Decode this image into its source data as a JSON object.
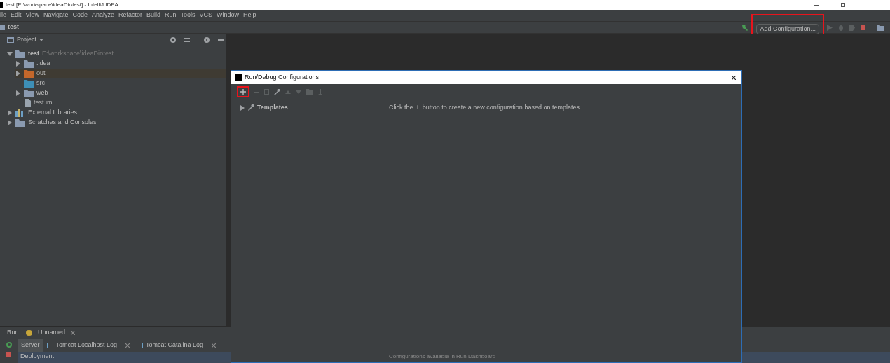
{
  "window": {
    "title": "test [E:\\workspace\\ideaDir\\test] - IntelliJ IDEA"
  },
  "menu": [
    "ile",
    "Edit",
    "View",
    "Navigate",
    "Code",
    "Analyze",
    "Refactor",
    "Build",
    "Run",
    "Tools",
    "VCS",
    "Window",
    "Help"
  ],
  "navbar": {
    "crumb": "test",
    "run_config": "Add Configuration...",
    "highlighted": true
  },
  "project": {
    "title": "Project",
    "tree": [
      {
        "name": "test",
        "path": "E:\\workspace\\ideaDir\\test",
        "kind": "module",
        "expanded": true,
        "selected": false,
        "children": [
          {
            "name": ".idea",
            "kind": "folder",
            "expanded": false,
            "selected": false
          },
          {
            "name": "out",
            "kind": "excluded",
            "expanded": false,
            "selected": true
          },
          {
            "name": "src",
            "kind": "source",
            "selected": false
          },
          {
            "name": "web",
            "kind": "folder",
            "expanded": false,
            "selected": false
          },
          {
            "name": "test.iml",
            "kind": "file",
            "selected": false
          }
        ]
      },
      {
        "name": "External Libraries",
        "kind": "libraries",
        "expanded": false,
        "selected": false
      },
      {
        "name": "Scratches and Consoles",
        "kind": "scratches",
        "expanded": false,
        "selected": false
      }
    ]
  },
  "dialog": {
    "title": "Run/Debug Configurations",
    "add_highlighted": true,
    "tree": [
      {
        "name": "Templates",
        "expanded": false
      }
    ],
    "hint_before": "Click the",
    "hint_plus": "+",
    "hint_after": "button to create a new configuration based on templates",
    "footer": "Configurations available in Run Dashboard"
  },
  "run_panel": {
    "label": "Run:",
    "tab": "Unnamed",
    "tabs": [
      {
        "label": "Server",
        "selected": true,
        "closable": false
      },
      {
        "label": "Tomcat Localhost Log",
        "selected": false,
        "closable": true
      },
      {
        "label": "Tomcat Catalina Log",
        "selected": false,
        "closable": true
      }
    ],
    "row": "Deployment"
  }
}
